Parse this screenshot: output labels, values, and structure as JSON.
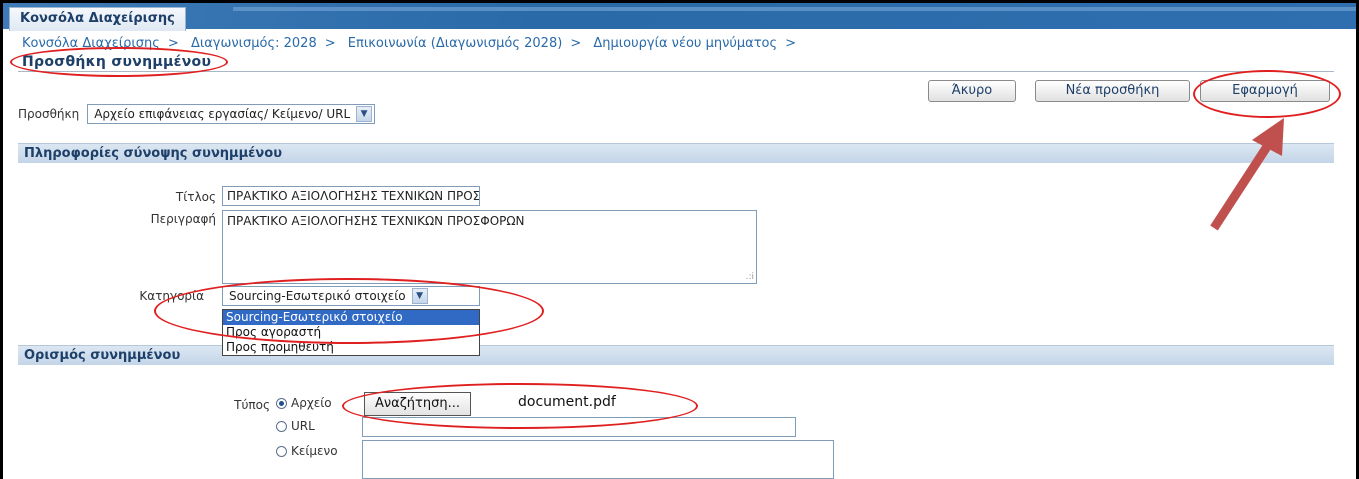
{
  "header": {
    "tab_label": "Κονσόλα Διαχείρισης"
  },
  "breadcrumb": {
    "items": [
      "Κονσόλα Διαχείρισης",
      "Διαγωνισμός: 2028",
      "Επικοινωνία (Διαγωνισμός 2028)",
      "Δημιουργία νέου μηνύματος"
    ],
    "separator": ">"
  },
  "page": {
    "title": "Προσθήκη συνημμένου"
  },
  "actions": {
    "cancel_label": "Άκυρο",
    "add_new_label": "Νέα προσθήκη",
    "apply_label": "Εφαρμογή"
  },
  "add_selector": {
    "label": "Προσθήκη",
    "value": "Αρχείο επιφάνειας εργασίας/ Κείμενο/ URL"
  },
  "summary_section": {
    "title": "Πληροφορίες σύνοψης συνημμένου",
    "title_label": "Τίτλος",
    "title_value": "ΠΡΑΚΤΙΚΟ ΑΞΙΟΛΟΓΗΣΗΣ ΤΕΧΝΙΚΩΝ ΠΡΟΣΦΟΡΩ",
    "description_label": "Περιγραφή",
    "description_value": "ΠΡΑΚΤΙΚΟ ΑΞΙΟΛΟΓΗΣΗΣ ΤΕΧΝΙΚΩΝ ΠΡΟΣΦΟΡΩΝ",
    "category_label": "Κατηγορία",
    "category_value": "Sourcing-Εσωτερικό στοιχείο",
    "category_options": [
      "Sourcing-Εσωτερικό στοιχείο",
      "Προς αγοραστή",
      "Προς προμηθευτή"
    ]
  },
  "definition_section": {
    "title": "Ορισμός συνημμένου",
    "type_label": "Τύπος",
    "options": {
      "file": "Αρχείο",
      "url": "URL",
      "text": "Κείμενο"
    },
    "selected_option": "file",
    "browse_label": "Αναζήτηση...",
    "file_name": "document.pdf"
  },
  "colors": {
    "header_blue": "#2a6aa8",
    "section_bg": "#c4d5e8",
    "annotation_red": "#e02020",
    "arrow_red": "#c0504d"
  }
}
